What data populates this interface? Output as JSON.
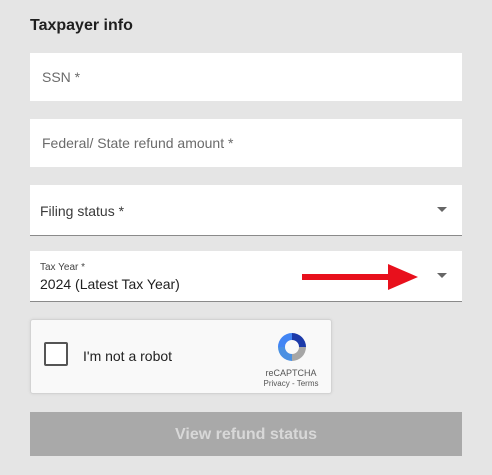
{
  "form": {
    "title": "Taxpayer info",
    "ssn_placeholder": "SSN *",
    "refund_placeholder": "Federal/ State refund amount *",
    "filing_status_label": "Filing status *",
    "tax_year_label": "Tax Year *",
    "tax_year_value": "2024 (Latest Tax Year)",
    "submit_label": "View refund status"
  },
  "captcha": {
    "label": "I'm not a robot",
    "brand": "reCAPTCHA",
    "privacy": "Privacy",
    "terms": "Terms"
  },
  "colors": {
    "background": "#e5e5e5",
    "arrow": "#e8101c",
    "button_disabled": "#a9a9a9"
  },
  "icons": [
    "chevron-down-icon",
    "red-arrow-annotation",
    "recaptcha-logo-icon",
    "checkbox-icon"
  ]
}
